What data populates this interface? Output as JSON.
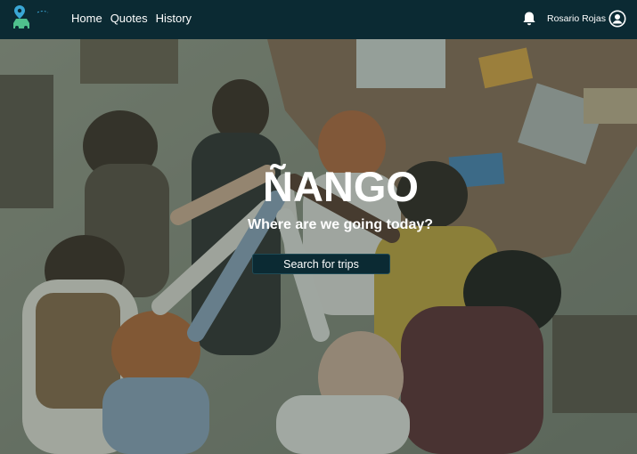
{
  "nav": {
    "logo_icon": "car-location-icon",
    "links": [
      {
        "label": "Home"
      },
      {
        "label": "Quotes"
      },
      {
        "label": "History"
      }
    ],
    "notification_icon": "bell-icon",
    "user_name": "Rosario Rojas",
    "user_icon": "user-circle-icon"
  },
  "hero": {
    "title": "ÑANGO",
    "subtitle": "Where are we going today?",
    "cta_label": "Search for trips",
    "image": "team-high-five-photo"
  },
  "colors": {
    "navbar": "#0b2a33",
    "button": "#0b2a33",
    "logo_accent": "#3aa7d6",
    "logo_car": "#4fc08d"
  }
}
